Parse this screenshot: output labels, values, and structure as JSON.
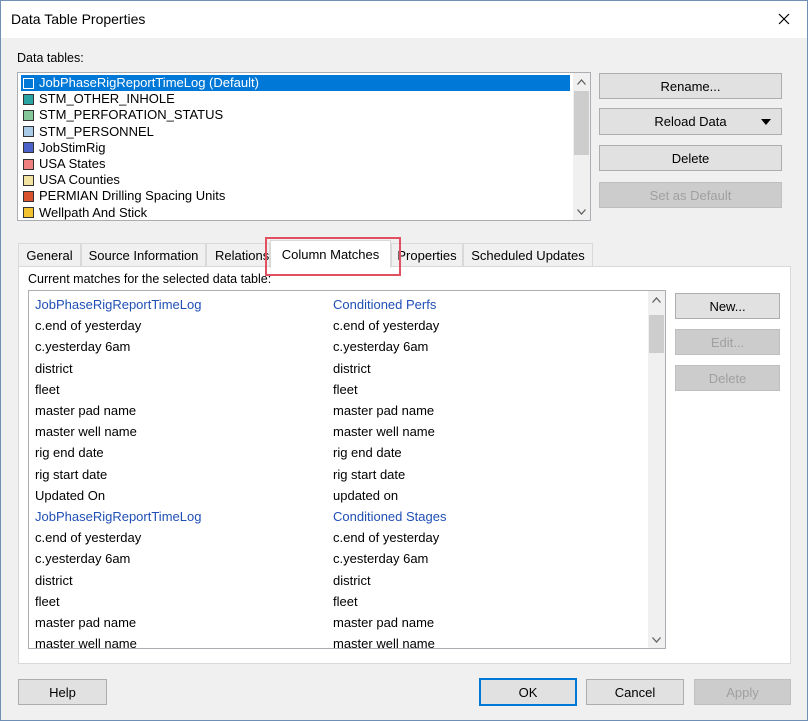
{
  "window": {
    "title": "Data Table Properties"
  },
  "data_tables": {
    "label": "Data tables:",
    "items": [
      {
        "label": "JobPhaseRigReportTimeLog (Default)",
        "color": "#0078d7",
        "selected": true
      },
      {
        "label": "STM_OTHER_INHOLE",
        "color": "#2aa3a3"
      },
      {
        "label": "STM_PERFORATION_STATUS",
        "color": "#86c79a"
      },
      {
        "label": "STM_PERSONNEL",
        "color": "#a9cbe8"
      },
      {
        "label": "JobStimRig",
        "color": "#4a62c9"
      },
      {
        "label": "USA States",
        "color": "#f08080"
      },
      {
        "label": "USA Counties",
        "color": "#f3e3a0"
      },
      {
        "label": "PERMIAN Drilling Spacing Units",
        "color": "#d9542e"
      },
      {
        "label": "Wellpath And Stick",
        "color": "#f2c230"
      }
    ]
  },
  "side_buttons": {
    "rename": "Rename...",
    "reload": "Reload Data",
    "delete": "Delete",
    "set_default": "Set as Default"
  },
  "tabs": [
    "General",
    "Source Information",
    "Relations",
    "Column Matches",
    "Properties",
    "Scheduled Updates"
  ],
  "column_matches": {
    "label": "Current matches for the selected data table:",
    "rows": [
      {
        "left": "JobPhaseRigReportTimeLog",
        "right": "Conditioned Perfs",
        "header": true
      },
      {
        "left": "c.end of yesterday",
        "right": "c.end of yesterday"
      },
      {
        "left": "c.yesterday 6am",
        "right": "c.yesterday 6am"
      },
      {
        "left": "district",
        "right": "district"
      },
      {
        "left": "fleet",
        "right": "fleet"
      },
      {
        "left": "master pad name",
        "right": "master pad name"
      },
      {
        "left": "master well name",
        "right": "master well name"
      },
      {
        "left": "rig end date",
        "right": "rig end date"
      },
      {
        "left": "rig start date",
        "right": "rig start date"
      },
      {
        "left": "Updated On",
        "right": "updated on"
      },
      {
        "left": "JobPhaseRigReportTimeLog",
        "right": "Conditioned Stages",
        "header": true
      },
      {
        "left": "c.end of yesterday",
        "right": "c.end of yesterday"
      },
      {
        "left": "c.yesterday 6am",
        "right": "c.yesterday 6am"
      },
      {
        "left": "district",
        "right": "district"
      },
      {
        "left": "fleet",
        "right": "fleet"
      },
      {
        "left": "master pad name",
        "right": "master pad name"
      },
      {
        "left": "master well name",
        "right": "master well name"
      }
    ],
    "buttons": {
      "new": "New...",
      "edit": "Edit...",
      "delete": "Delete"
    }
  },
  "footer": {
    "help": "Help",
    "ok": "OK",
    "cancel": "Cancel",
    "apply": "Apply"
  }
}
